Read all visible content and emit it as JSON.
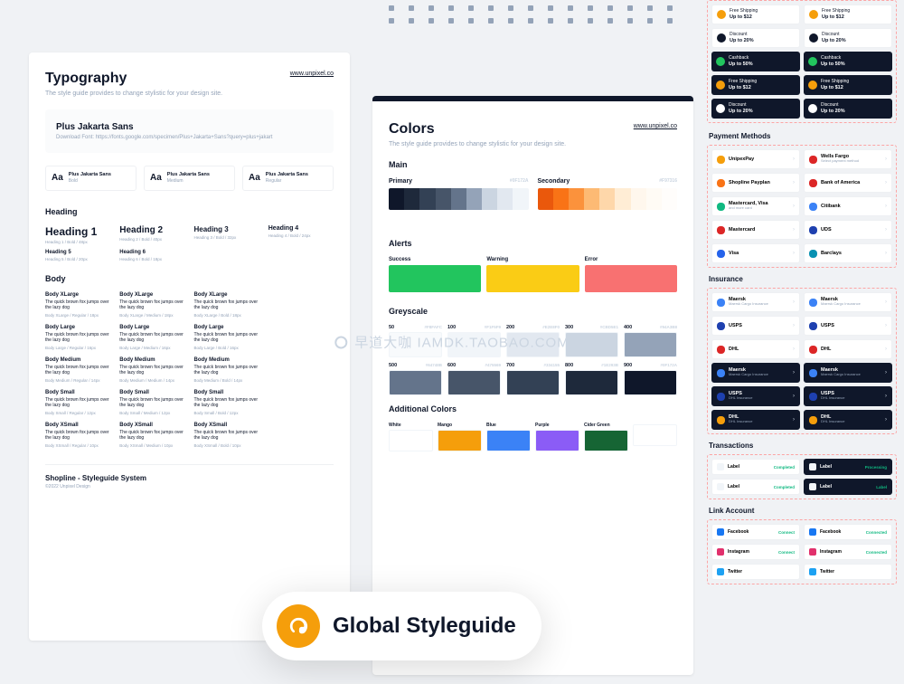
{
  "typography": {
    "title": "Typography",
    "subtitle": "The style guide provides to change stylistic for your design site.",
    "url": "www.unpixel.co",
    "font": {
      "name": "Plus Jakarta Sans",
      "link": "Download Font: https://fonts.google.com/specimen/Plus+Jakarta+Sans?query=plus+jakart"
    },
    "weights": [
      {
        "name": "Plus Jakarta Sans",
        "w": "Bold"
      },
      {
        "name": "Plus Jakarta Sans",
        "w": "Medium"
      },
      {
        "name": "Plus Jakarta Sans",
        "w": "Regular"
      }
    ],
    "heading_section": "Heading",
    "headings": [
      {
        "label": "Heading 1",
        "meta": "Heading 1 / Bold / 48px",
        "cls": "h1"
      },
      {
        "label": "Heading 2",
        "meta": "Heading 2 / Bold / 40px",
        "cls": "h2"
      },
      {
        "label": "Heading 3",
        "meta": "Heading 3 / Bold / 32px",
        "cls": "h3"
      },
      {
        "label": "Heading 4",
        "meta": "Heading 4 / Bold / 24px",
        "cls": "h4"
      },
      {
        "label": "Heading 5",
        "meta": "Heading 5 / Bold / 20px",
        "cls": "h5"
      },
      {
        "label": "Heading 6",
        "meta": "Heading 6 / Bold / 18px",
        "cls": "h6"
      }
    ],
    "body_section": "Body",
    "bodies": [
      {
        "title": "Body XLarge",
        "txt": "The quick brown fox jumps over the lazy dog",
        "meta": "Body XLarge / Regular / 18px"
      },
      {
        "title": "Body XLarge",
        "txt": "The quick brown fox jumps over the lazy dog",
        "meta": "Body XLarge / Medium / 18px"
      },
      {
        "title": "Body XLarge",
        "txt": "The quick brown fox jumps over the lazy dog",
        "meta": "Body XLarge / Bold / 18px"
      },
      {
        "title": "",
        "txt": "",
        "meta": ""
      },
      {
        "title": "Body Large",
        "txt": "The quick brown fox jumps over the lazy dog",
        "meta": "Body Large / Regular / 16px"
      },
      {
        "title": "Body Large",
        "txt": "The quick brown fox jumps over the lazy dog",
        "meta": "Body Large / Medium / 16px"
      },
      {
        "title": "Body Large",
        "txt": "The quick brown fox jumps over the lazy dog",
        "meta": "Body Large / Bold / 16px"
      },
      {
        "title": "",
        "txt": "",
        "meta": ""
      },
      {
        "title": "Body Medium",
        "txt": "The quick brown fox jumps over the lazy dog",
        "meta": "Body Medium / Regular / 14px"
      },
      {
        "title": "Body Medium",
        "txt": "The quick brown fox jumps over the lazy dog",
        "meta": "Body Medium / Medium / 14px"
      },
      {
        "title": "Body Medium",
        "txt": "The quick brown fox jumps over the lazy dog",
        "meta": "Body Medium / Bold / 14px"
      },
      {
        "title": "",
        "txt": "",
        "meta": ""
      },
      {
        "title": "Body Small",
        "txt": "The quick brown fox jumps over the lazy dog",
        "meta": "Body Small / Regular / 12px"
      },
      {
        "title": "Body Small",
        "txt": "The quick brown fox jumps over the lazy dog",
        "meta": "Body Small / Medium / 12px"
      },
      {
        "title": "Body Small",
        "txt": "The quick brown fox jumps over the lazy dog",
        "meta": "Body Small / Bold / 12px"
      },
      {
        "title": "",
        "txt": "",
        "meta": ""
      },
      {
        "title": "Body XSmall",
        "txt": "The quick brown fox jumps over the lazy dog",
        "meta": "Body XSmall / Regular / 10px"
      },
      {
        "title": "Body XSmall",
        "txt": "The quick brown fox jumps over the lazy dog",
        "meta": "Body XSmall / Medium / 10px"
      },
      {
        "title": "Body XSmall",
        "txt": "The quick brown fox jumps over the lazy dog",
        "meta": "Body XSmall / Bold / 10px"
      },
      {
        "title": "",
        "txt": "",
        "meta": ""
      }
    ],
    "footer": "Shopline - Styleguide System",
    "copyright": "©2022 Unpixel Design"
  },
  "colors": {
    "title": "Colors",
    "subtitle": "The style guide provides to change stylistic for your design site.",
    "url": "www.unpixel.co",
    "main_section": "Main",
    "primary_label": "Primary",
    "primary_hex": "#0F172A",
    "secondary_label": "Secondary",
    "secondary_hex": "#F97316",
    "primary_shades": [
      "#0f172a",
      "#1e293b",
      "#334155",
      "#475569",
      "#64748b",
      "#94a3b8",
      "#cbd5e1",
      "#e2e8f0",
      "#f1f5f9"
    ],
    "secondary_shades": [
      "#ea580c",
      "#f97316",
      "#fb923c",
      "#fdba74",
      "#fed7aa",
      "#ffedd5",
      "#fff7ed",
      "#fffbf5",
      "#fffdfb"
    ],
    "alerts_section": "Alerts",
    "alerts": [
      {
        "label": "Success",
        "c": "#22c55e"
      },
      {
        "label": "Warning",
        "c": "#facc15"
      },
      {
        "label": "Error",
        "c": "#f87171"
      }
    ],
    "grey_section": "Greyscale",
    "greys": [
      {
        "label": "50",
        "hex": "#F8FAFC",
        "c": "#f8fafc"
      },
      {
        "label": "100",
        "hex": "#F1F5F9",
        "c": "#f1f5f9"
      },
      {
        "label": "200",
        "hex": "#E2E8F0",
        "c": "#e2e8f0"
      },
      {
        "label": "300",
        "hex": "#CBD5E1",
        "c": "#cbd5e1"
      },
      {
        "label": "400",
        "hex": "#94A3B8",
        "c": "#94a3b8"
      },
      {
        "label": "500",
        "hex": "#64748B",
        "c": "#64748b"
      },
      {
        "label": "600",
        "hex": "#475569",
        "c": "#475569"
      },
      {
        "label": "700",
        "hex": "#334155",
        "c": "#334155"
      },
      {
        "label": "800",
        "hex": "#1E293B",
        "c": "#1e293b"
      },
      {
        "label": "900",
        "hex": "#0F172A",
        "c": "#0f172a"
      }
    ],
    "add_section": "Additional Colors",
    "additional": [
      {
        "label": "White",
        "c": "#ffffff"
      },
      {
        "label": "Mango",
        "c": "#f59e0b"
      },
      {
        "label": "Blue",
        "c": "#3b82f6"
      },
      {
        "label": "Purple",
        "c": "#8b5cf6"
      },
      {
        "label": "Cider Green",
        "c": "#166534"
      },
      {
        "label": "",
        "c": "transparent"
      }
    ]
  },
  "side": {
    "promos": [
      {
        "ic": "#f59e0b",
        "t": "Free Shipping",
        "b": "Up to $12",
        "cls": "light"
      },
      {
        "ic": "#f59e0b",
        "t": "Free Shipping",
        "b": "Up to $12",
        "cls": "light"
      },
      {
        "ic": "#0f172a",
        "t": "Discount",
        "b": "Up to 20%",
        "cls": "light"
      },
      {
        "ic": "#0f172a",
        "t": "Discount",
        "b": "Up to 20%",
        "cls": "light"
      },
      {
        "ic": "#22c55e",
        "t": "Cashback",
        "b": "Up to 50%",
        "cls": "dark"
      },
      {
        "ic": "#22c55e",
        "t": "Cashback",
        "b": "Up to 50%",
        "cls": "dark"
      },
      {
        "ic": "#f59e0b",
        "t": "Free Shipping",
        "b": "Up to $12",
        "cls": "dark"
      },
      {
        "ic": "#f59e0b",
        "t": "Free Shipping",
        "b": "Up to $12",
        "cls": "dark"
      },
      {
        "ic": "#fff",
        "t": "Discount",
        "b": "Up to 20%",
        "cls": "dark"
      },
      {
        "ic": "#fff",
        "t": "Discount",
        "b": "Up to 20%",
        "cls": "dark"
      }
    ],
    "payment_title": "Payment Methods",
    "payments": [
      {
        "ic": "#f59e0b",
        "name": "UnipexPay",
        "sub": "",
        "cls": "light"
      },
      {
        "ic": "#dc2626",
        "name": "Wells Fargo",
        "sub": "Select payment method",
        "cls": "light"
      },
      {
        "ic": "#f97316",
        "name": "Shopline Payplan",
        "sub": "",
        "cls": "light"
      },
      {
        "ic": "#dc2626",
        "name": "Bank of America",
        "sub": "",
        "cls": "light"
      },
      {
        "ic": "#10b981",
        "name": "Mastercard, Visa",
        "sub": "and more card",
        "cls": "light"
      },
      {
        "ic": "#3b82f6",
        "name": "Citibank",
        "sub": "",
        "cls": "light"
      },
      {
        "ic": "#dc2626",
        "name": "Mastercard",
        "sub": "",
        "cls": "light"
      },
      {
        "ic": "#1e40af",
        "name": "UDS",
        "sub": "",
        "cls": "light"
      },
      {
        "ic": "#2563eb",
        "name": "Visa",
        "sub": "",
        "cls": "light"
      },
      {
        "ic": "#0891b2",
        "name": "Barclays",
        "sub": "",
        "cls": "light"
      }
    ],
    "insurance_title": "Insurance",
    "insurance": [
      {
        "ic": "#3b82f6",
        "name": "Maersk",
        "sub": "Maersk Cargo Insurance",
        "cls": "light"
      },
      {
        "ic": "#3b82f6",
        "name": "Maersk",
        "sub": "Maersk Cargo Insurance",
        "cls": "light"
      },
      {
        "ic": "#1e40af",
        "name": "USPS",
        "sub": "",
        "cls": "light"
      },
      {
        "ic": "#1e40af",
        "name": "USPS",
        "sub": "",
        "cls": "light"
      },
      {
        "ic": "#dc2626",
        "name": "DHL",
        "sub": "",
        "cls": "light"
      },
      {
        "ic": "#dc2626",
        "name": "DHL",
        "sub": "",
        "cls": "light"
      },
      {
        "ic": "#3b82f6",
        "name": "Maersk",
        "sub": "Maersk Cargo Insurance",
        "cls": "dark"
      },
      {
        "ic": "#3b82f6",
        "name": "Maersk",
        "sub": "Maersk Cargo Insurance",
        "cls": "dark"
      },
      {
        "ic": "#1e40af",
        "name": "USPS",
        "sub": "DHL Insurance",
        "cls": "dark"
      },
      {
        "ic": "#1e40af",
        "name": "USPS",
        "sub": "DHL Insurance",
        "cls": "dark"
      },
      {
        "ic": "#f59e0b",
        "name": "DHL",
        "sub": "DHL Insurance",
        "cls": "dark"
      },
      {
        "ic": "#f59e0b",
        "name": "DHL",
        "sub": "DHL Insurance",
        "cls": "dark"
      }
    ],
    "trans_title": "Transactions",
    "trans": [
      {
        "lab": "Label",
        "badge": "Completed",
        "cls": "light"
      },
      {
        "lab": "Label",
        "badge": "Processing",
        "cls": "dark"
      },
      {
        "lab": "Label",
        "badge": "Completed",
        "cls": "light"
      },
      {
        "lab": "Label",
        "badge": "Label",
        "cls": "dark"
      }
    ],
    "link_title": "Link Account",
    "links": [
      {
        "ic": "#1877f2",
        "name": "Facebook",
        "badge": "Connect",
        "cls": "light"
      },
      {
        "ic": "#1877f2",
        "name": "Facebook",
        "badge": "Connected",
        "cls": "light"
      },
      {
        "ic": "#e1306c",
        "name": "Instagram",
        "badge": "Connect",
        "cls": "light"
      },
      {
        "ic": "#e1306c",
        "name": "Instagram",
        "badge": "Connected",
        "cls": "light"
      },
      {
        "ic": "#1da1f2",
        "name": "Twitter",
        "badge": "",
        "cls": "light"
      },
      {
        "ic": "#1da1f2",
        "name": "Twitter",
        "badge": "",
        "cls": "light"
      }
    ]
  },
  "badge": {
    "text": "Global Styleguide"
  },
  "watermark": "早道大咖  IAMDK.TAOBAO.COM"
}
